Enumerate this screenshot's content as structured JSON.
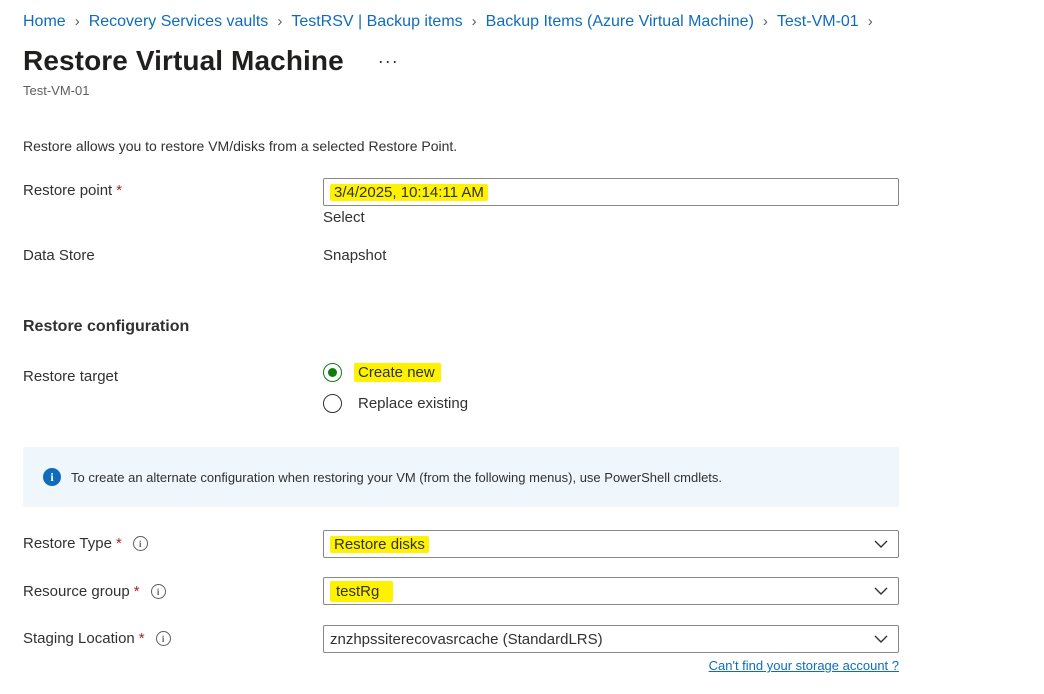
{
  "breadcrumb": [
    "Home",
    "Recovery Services vaults",
    "TestRSV | Backup items",
    "Backup Items (Azure Virtual Machine)",
    "Test-VM-01"
  ],
  "page": {
    "title": "Restore Virtual Machine",
    "more_label": "···",
    "subtitle": "Test-VM-01",
    "intro": "Restore allows you to restore VM/disks from a selected Restore Point."
  },
  "restore_point": {
    "label": "Restore point",
    "required_mark": "*",
    "value": "3/4/2025, 10:14:11 AM",
    "select_label": "Select"
  },
  "data_store": {
    "label": "Data Store",
    "value": "Snapshot"
  },
  "restore_configuration": {
    "heading": "Restore configuration",
    "target_label": "Restore target",
    "options": [
      "Create new",
      "Replace existing"
    ],
    "selected": "Create new"
  },
  "info_box": {
    "text": "To create an alternate configuration when restoring your VM (from the following menus), use PowerShell cmdlets."
  },
  "restore_type": {
    "label": "Restore Type",
    "required_mark": "*",
    "value": "Restore disks"
  },
  "resource_group": {
    "label": "Resource group",
    "required_mark": "*",
    "value": "testRg"
  },
  "staging_location": {
    "label": "Staging Location",
    "required_mark": "*",
    "value": "znzhpssiterecovasrcache (StandardLRS)",
    "help_link": "Can't find your storage account ?"
  },
  "colors": {
    "link": "#0f6cbd",
    "highlight": "#fff200",
    "radio_selected": "#107c10",
    "info_bg": "#eff6fc"
  }
}
